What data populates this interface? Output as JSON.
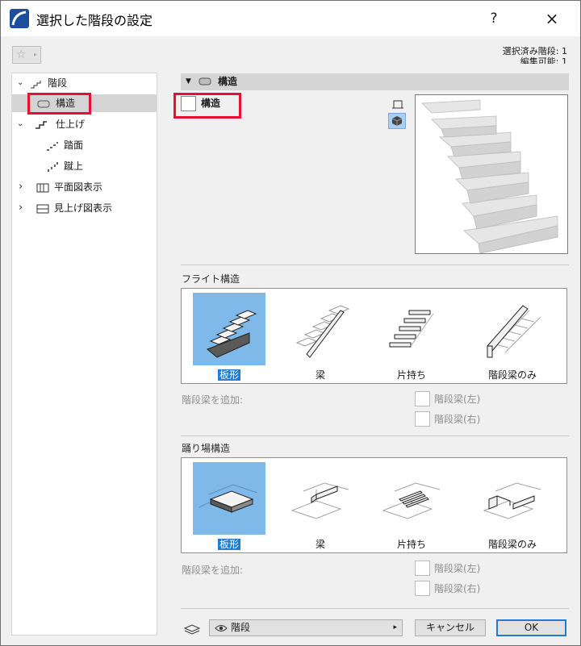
{
  "title": "選択した階段の設定",
  "titlebar": {
    "help_label": "?",
    "close_glyph": "×"
  },
  "selection": {
    "selected": "選択済み階段: 1",
    "editable": "編集可能: 1"
  },
  "favorites": {
    "star_glyph": "☆",
    "arrow_glyph": "▸"
  },
  "tree": {
    "items": [
      {
        "label": "階段",
        "icon": "stair-icon"
      },
      {
        "label": "構造",
        "icon": "structure-icon"
      },
      {
        "label": "仕上げ",
        "icon": "finish-icon"
      },
      {
        "label": "踏面",
        "icon": "tread-icon"
      },
      {
        "label": "蹴上",
        "icon": "riser-icon"
      },
      {
        "label": "平面図表示",
        "icon": "floor-plan-icon"
      },
      {
        "label": "見上げ図表示",
        "icon": "ceiling-plan-icon"
      }
    ],
    "expand_glyph": "⌄",
    "collapse_glyph": "›"
  },
  "section": {
    "title": "構造",
    "checkbox_label": "構造"
  },
  "flight": {
    "title": "フライト構造",
    "options": [
      {
        "label": "板形",
        "selected": true
      },
      {
        "label": "梁",
        "selected": false
      },
      {
        "label": "片持ち",
        "selected": false
      },
      {
        "label": "階段梁のみ",
        "selected": false
      }
    ],
    "add_beam_label": "階段梁を追加:",
    "beam_left": "階段梁(左)",
    "beam_right": "階段梁(右)"
  },
  "landing": {
    "title": "踊り場構造",
    "options": [
      {
        "label": "板形",
        "selected": true
      },
      {
        "label": "梁",
        "selected": false
      },
      {
        "label": "片持ち",
        "selected": false
      },
      {
        "label": "階段梁のみ",
        "selected": false
      }
    ],
    "add_beam_label": "階段梁を追加:",
    "beam_left": "階段梁(左)",
    "beam_right": "階段梁(右)"
  },
  "footer": {
    "layer_value": "階段",
    "arrow_glyph": "▸",
    "cancel_label": "キャンセル",
    "ok_label": "OK"
  },
  "colors": {
    "accent": "#1e7bd6",
    "selected_option_bg": "#7eb9ea",
    "highlight_box": "#e8112d"
  }
}
